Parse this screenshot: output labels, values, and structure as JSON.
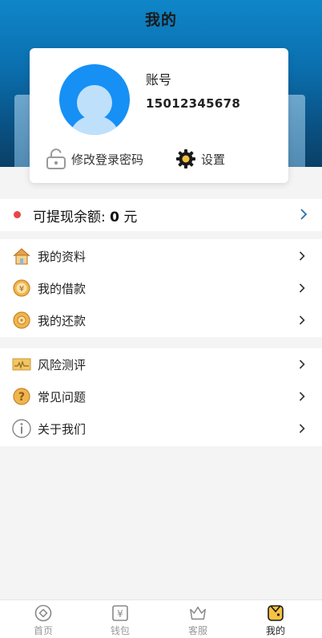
{
  "header": {
    "title": "我的"
  },
  "profile": {
    "account_label": "账号",
    "phone": "15012345678",
    "change_password_label": "修改登录密码",
    "settings_label": "设置"
  },
  "withdraw": {
    "prefix": "可提现余额: ",
    "amount": "0",
    "unit": " 元",
    "dot_color": "#e8454a"
  },
  "menu_group_1": [
    {
      "label": "我的资料",
      "icon": "house-icon"
    },
    {
      "label": "我的借款",
      "icon": "yuan-coin-icon"
    },
    {
      "label": "我的还款",
      "icon": "coin-icon"
    }
  ],
  "menu_group_2": [
    {
      "label": "风险测评",
      "icon": "chart-card-icon"
    },
    {
      "label": "常见问题",
      "icon": "question-icon"
    },
    {
      "label": "关于我们",
      "icon": "info-icon"
    }
  ],
  "tabbar": [
    {
      "label": "首页",
      "icon": "home-circle-icon",
      "active": false
    },
    {
      "label": "钱包",
      "icon": "wallet-yuan-icon",
      "active": false
    },
    {
      "label": "客服",
      "icon": "crown-icon",
      "active": false
    },
    {
      "label": "我的",
      "icon": "profile-icon",
      "active": true
    }
  ],
  "colors": {
    "header_blue": "#0f86c9",
    "avatar_blue": "#1690f4",
    "accent_yellow": "#f5c242"
  }
}
